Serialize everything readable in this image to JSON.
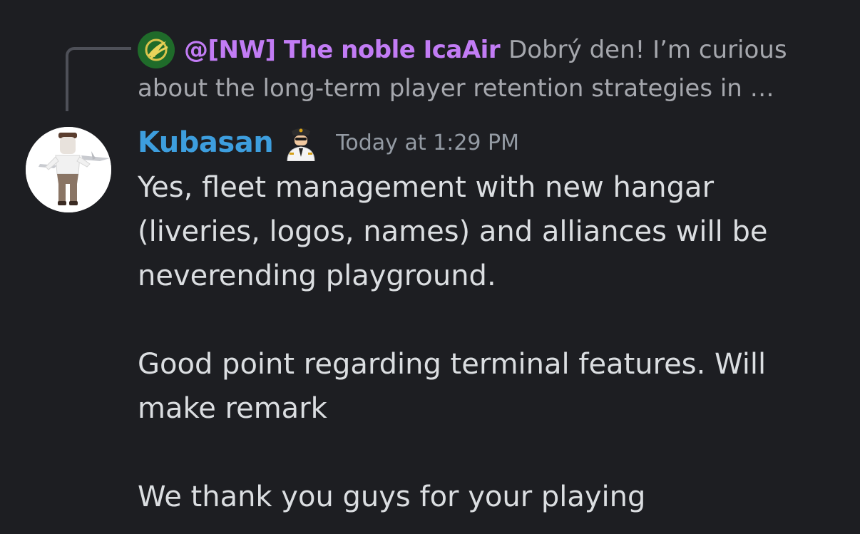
{
  "reply": {
    "author": "@[NW] The noble IcaAir",
    "preview_line1": "Dobrý den! I’m curious",
    "preview_line2": "about the long-term player retention strategies in …"
  },
  "message": {
    "author": "Kubasan",
    "timestamp": "Today at 1:29 PM",
    "paragraphs": [
      "Yes, fleet management with new hangar (liveries, logos, names) and alliances will be neverending playground.",
      "Good point regarding terminal features. Will make remark",
      "We thank you guys for your playing"
    ]
  },
  "colors": {
    "background": "#1d1e22",
    "reply_author": "#c27cf5",
    "author": "#3d9ede",
    "text": "#dbdee1",
    "muted": "#a5a7ad"
  },
  "icons": {
    "reply_avatar": "airline-logo-icon",
    "role_badge": "pilot-icon",
    "avatar": "user-avatar"
  }
}
